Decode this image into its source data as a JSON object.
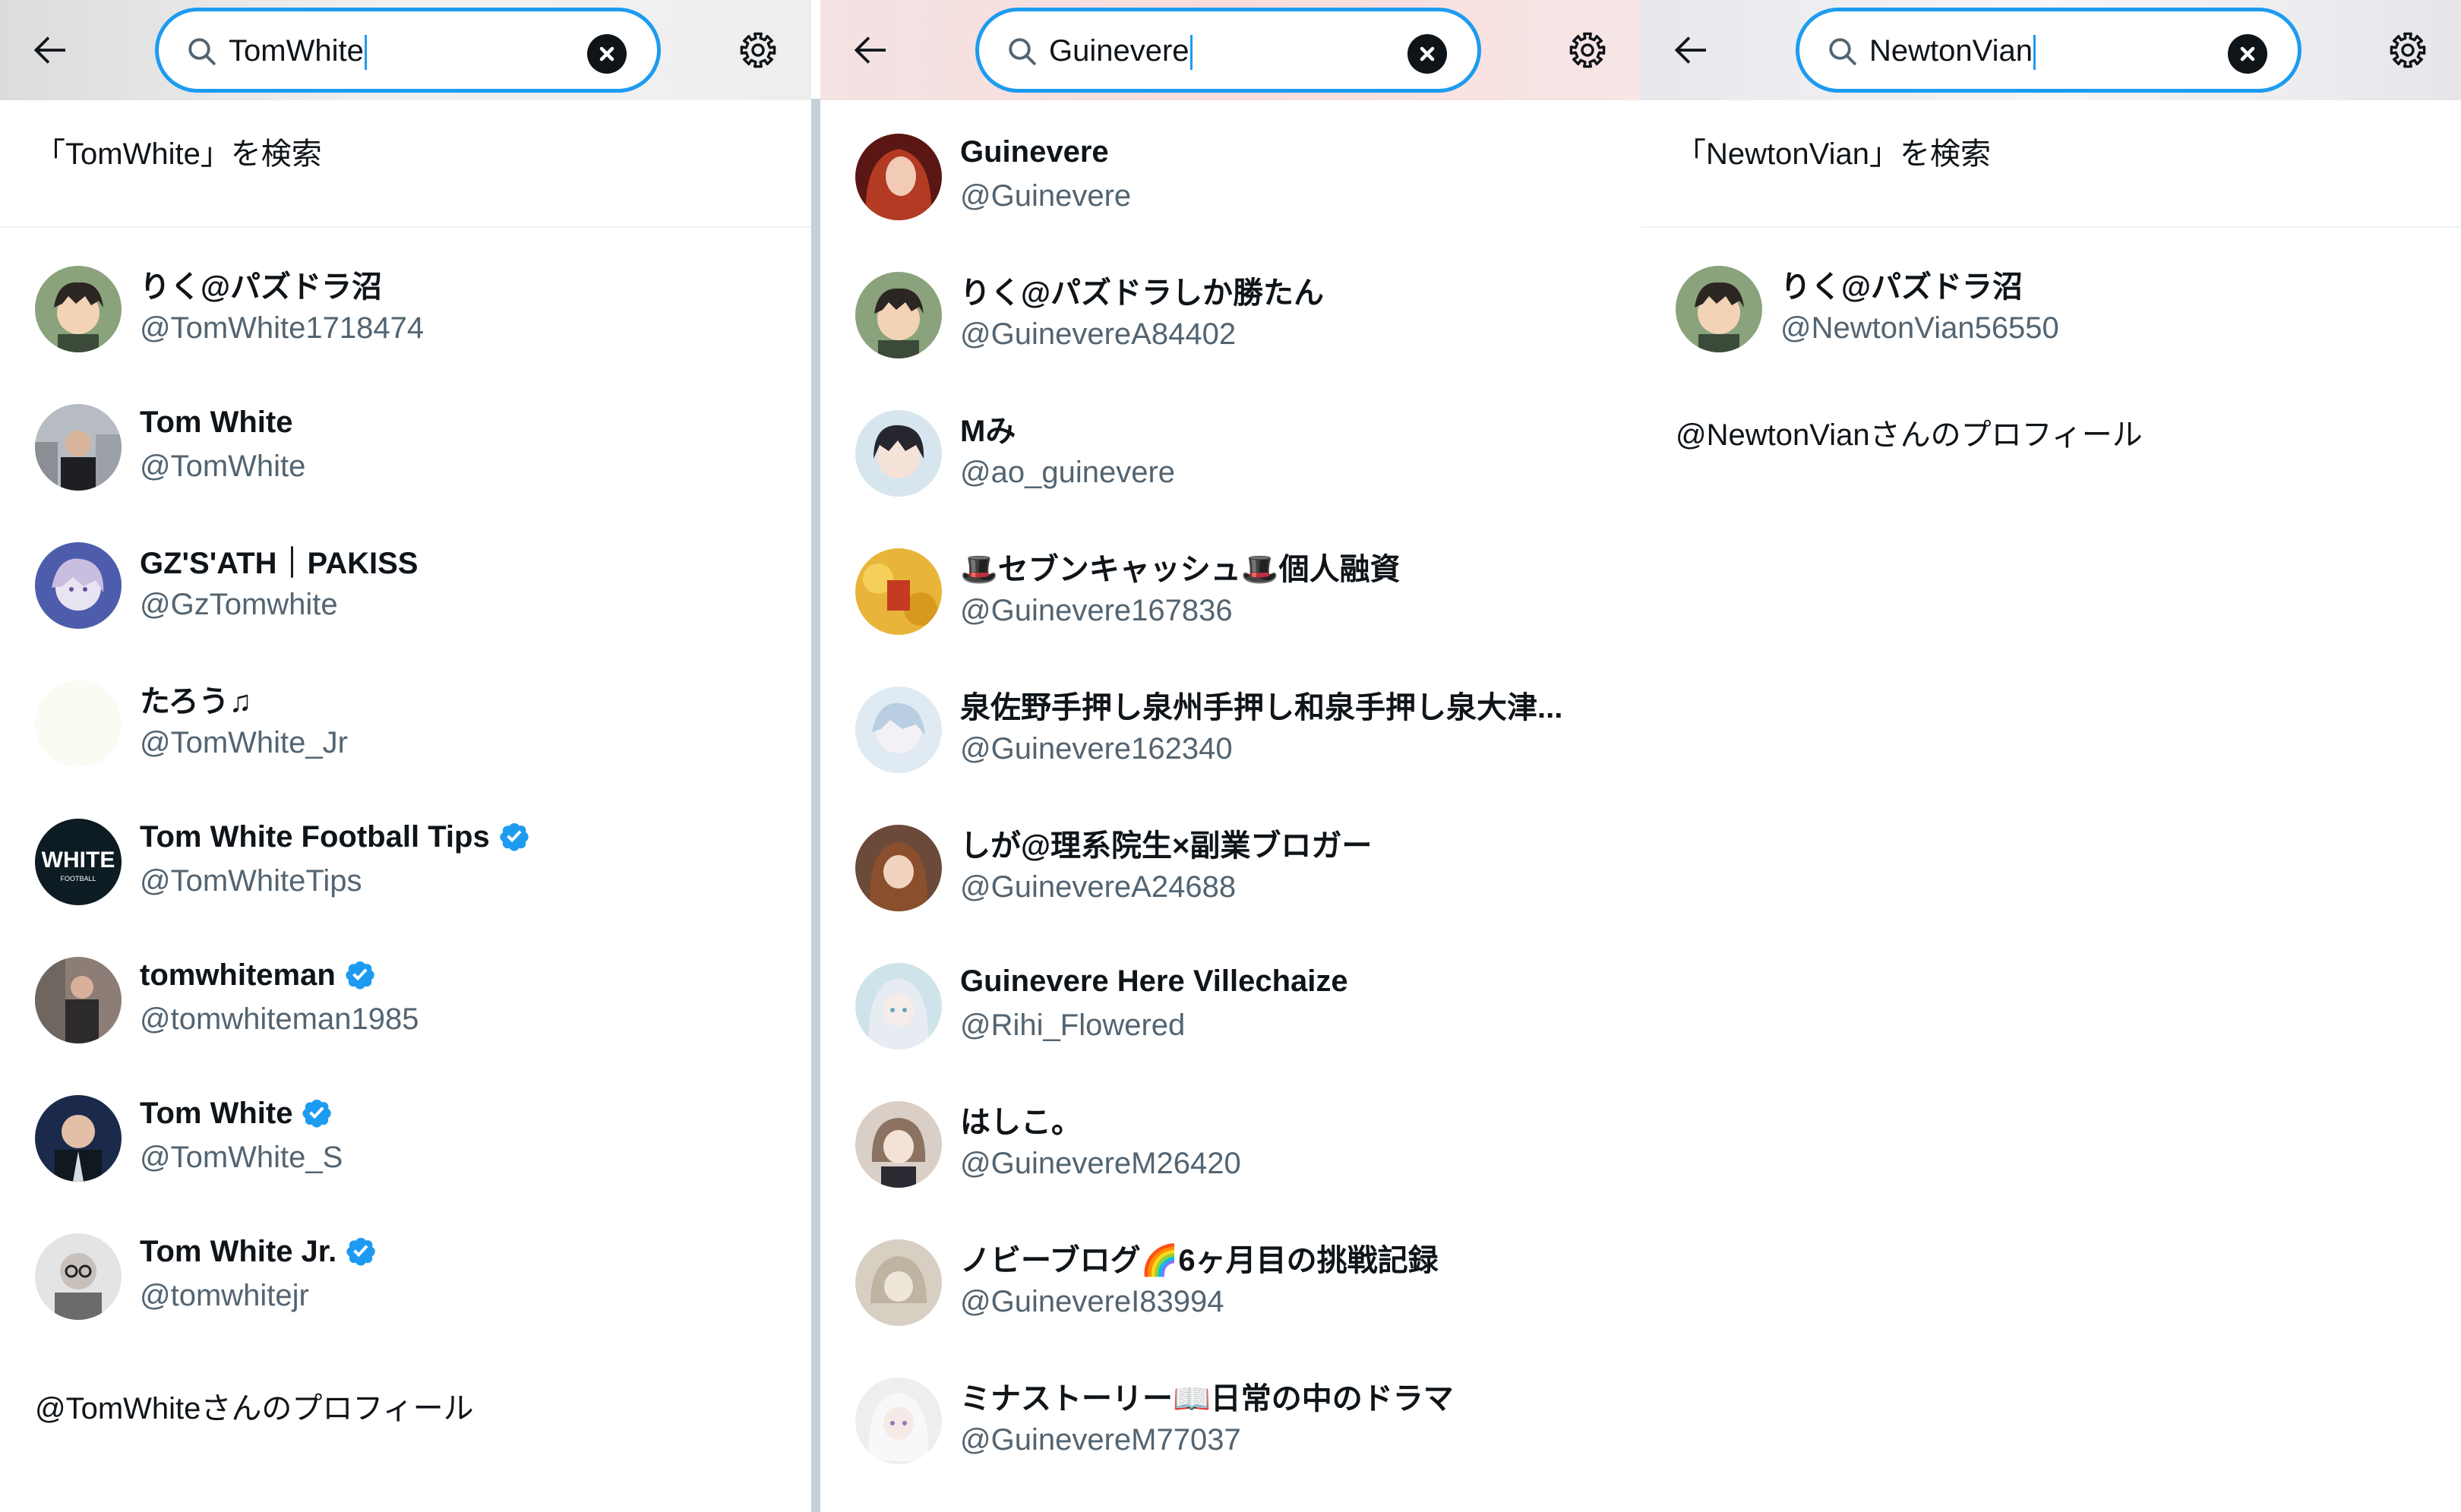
{
  "colors": {
    "accent": "#1d9bf0",
    "text": "#0f1419",
    "muted": "#536471",
    "divider": "#c4cfd6"
  },
  "panels": [
    {
      "search": {
        "value": "TomWhite"
      },
      "search_for": "「TomWhite」を検索",
      "results": [
        {
          "name": "りく@パズドラ沼",
          "handle": "@TomWhite1718474",
          "verified": false,
          "avatar": "anime-boy"
        },
        {
          "name": "Tom White",
          "handle": "@TomWhite",
          "verified": false,
          "avatar": "city-man"
        },
        {
          "name": "GZ'S'ATH｜PAKISS",
          "handle": "@GzTomwhite",
          "verified": false,
          "avatar": "purple-anime"
        },
        {
          "name": "たろう♫",
          "handle": "@TomWhite_Jr",
          "verified": false,
          "avatar": "blank"
        },
        {
          "name": "Tom White Football Tips",
          "handle": "@TomWhiteTips",
          "verified": true,
          "avatar": "white-logo"
        },
        {
          "name": "tomwhiteman",
          "handle": "@tomwhiteman1985",
          "verified": true,
          "avatar": "gym"
        },
        {
          "name": "Tom White",
          "handle": "@TomWhite_S",
          "verified": true,
          "avatar": "bald-man"
        },
        {
          "name": "Tom White Jr.",
          "handle": "@tomwhitejr",
          "verified": true,
          "avatar": "glasses-man"
        }
      ],
      "profile_link": "@TomWhiteさんのプロフィール"
    },
    {
      "search": {
        "value": "Guinevere"
      },
      "results": [
        {
          "name": "Guinevere",
          "handle": "@Guinevere",
          "verified": false,
          "avatar": "red-hair"
        },
        {
          "name": "りく@パズドラしか勝たん",
          "handle": "@GuinevereA84402",
          "verified": false,
          "avatar": "anime-boy"
        },
        {
          "name": "Mみ",
          "handle": "@ao_guinevere",
          "verified": false,
          "avatar": "dark-hair"
        },
        {
          "name": "🎩セブンキャッシュ🎩個人融資",
          "handle": "@Guinevere167836",
          "verified": false,
          "avatar": "gold"
        },
        {
          "name": "泉佐野手押し泉州手押し和泉手押し泉大津...",
          "handle": "@Guinevere162340",
          "verified": false,
          "avatar": "pastel"
        },
        {
          "name": "しが@理系院生×副業ブロガー",
          "handle": "@GuinevereA24688",
          "verified": false,
          "avatar": "brown-anime"
        },
        {
          "name": "Guinevere Here Villechaize",
          "handle": "@Rihi_Flowered",
          "verified": false,
          "avatar": "silver-anime"
        },
        {
          "name": "はしこ。",
          "handle": "@GuinevereM26420",
          "verified": false,
          "avatar": "maid"
        },
        {
          "name": "ノビーブログ🌈6ヶ月目の挑戦記録",
          "handle": "@GuinevereI83994",
          "verified": false,
          "avatar": "beige"
        },
        {
          "name": "ミナストーリー📖日常の中のドラマ",
          "handle": "@GuinevereM77037",
          "verified": false,
          "avatar": "white-hair"
        }
      ]
    },
    {
      "search": {
        "value": "NewtonVian"
      },
      "search_for": "「NewtonVian」を検索",
      "results": [
        {
          "name": "りく@パズドラ沼",
          "handle": "@NewtonVian56550",
          "verified": false,
          "avatar": "anime-boy"
        }
      ],
      "profile_link": "@NewtonVianさんのプロフィール"
    }
  ]
}
